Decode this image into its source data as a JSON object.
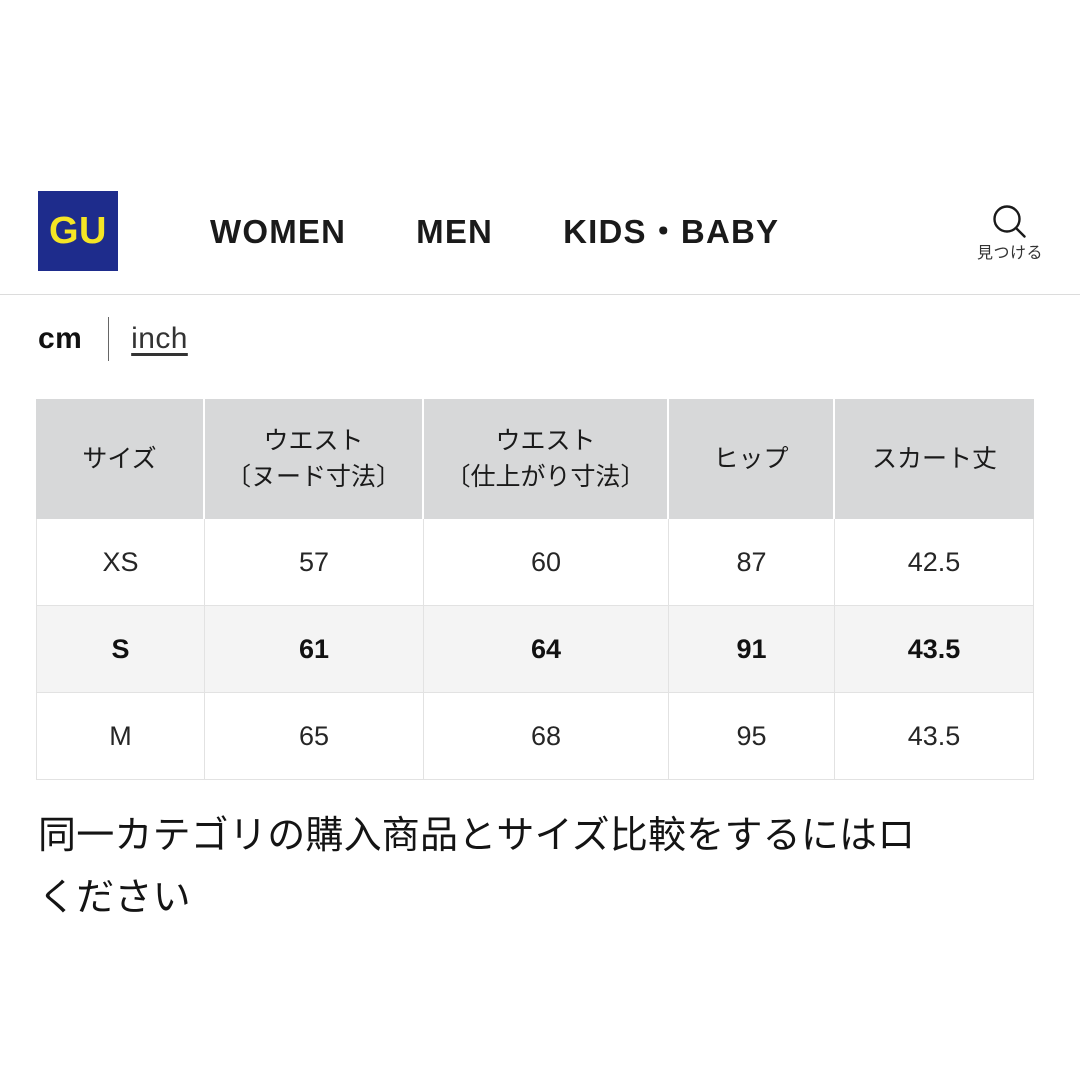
{
  "header": {
    "logo_text": "GU",
    "logo_bg_color": "#1e2c8c",
    "logo_fg_color": "#f5e525",
    "nav_items": [
      {
        "label": "WOMEN",
        "name": "nav-item-women"
      },
      {
        "label": "MEN",
        "name": "nav-item-men"
      },
      {
        "label": "KIDS・BABY",
        "name": "nav-item-kids-baby"
      }
    ],
    "search": {
      "icon": "search-icon",
      "label": "見つける"
    }
  },
  "unit_toggle": {
    "active_label": "cm",
    "link_label": "inch",
    "separator": "|"
  },
  "size_table": {
    "headers": [
      {
        "line1": "サイズ",
        "line2": ""
      },
      {
        "line1": "ウエスト",
        "line2": "〔ヌード寸法〕"
      },
      {
        "line1": "ウエスト",
        "line2": "〔仕上がり寸法〕"
      },
      {
        "line1": "ヒップ",
        "line2": ""
      },
      {
        "line1": "スカート丈",
        "line2": ""
      }
    ],
    "rows": [
      {
        "size": "XS",
        "waist_nude": "57",
        "waist_finished": "60",
        "hip": "87",
        "skirt_length": "42.5",
        "highlight": false
      },
      {
        "size": "S",
        "waist_nude": "61",
        "waist_finished": "64",
        "hip": "91",
        "skirt_length": "43.5",
        "highlight": true
      },
      {
        "size": "M",
        "waist_nude": "65",
        "waist_finished": "68",
        "hip": "95",
        "skirt_length": "43.5",
        "highlight": false
      }
    ],
    "header_bg_color": "#d7d8d9",
    "highlight_bg_color": "#f4f4f4"
  },
  "note": {
    "line1": "同一カテゴリの購入商品とサイズ比較をするにはロ",
    "line2": "ください"
  }
}
